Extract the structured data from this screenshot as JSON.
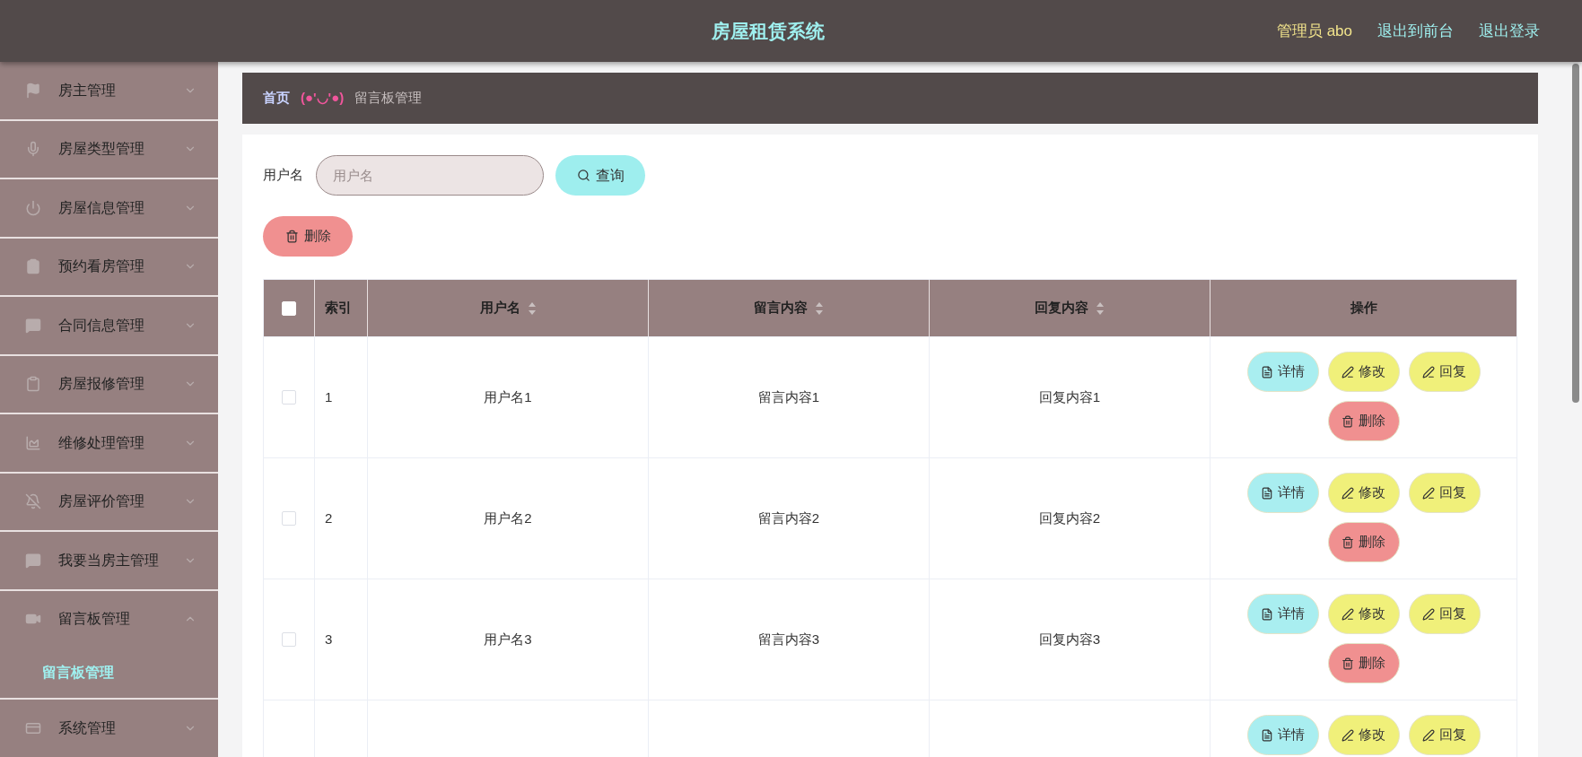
{
  "header": {
    "title": "房屋租赁系统",
    "user": "管理员 abo",
    "links": [
      "退出到前台",
      "退出登录"
    ]
  },
  "sidebar": {
    "items": [
      {
        "label": "房主管理",
        "expanded": false
      },
      {
        "label": "房屋类型管理",
        "expanded": false
      },
      {
        "label": "房屋信息管理",
        "expanded": false
      },
      {
        "label": "预约看房管理",
        "expanded": false
      },
      {
        "label": "合同信息管理",
        "expanded": false
      },
      {
        "label": "房屋报修管理",
        "expanded": false
      },
      {
        "label": "维修处理管理",
        "expanded": false
      },
      {
        "label": "房屋评价管理",
        "expanded": false
      },
      {
        "label": "我要当房主管理",
        "expanded": false
      },
      {
        "label": "留言板管理",
        "expanded": true,
        "children": [
          {
            "label": "留言板管理",
            "selected": true
          }
        ]
      },
      {
        "label": "系统管理",
        "expanded": false
      }
    ]
  },
  "breadcrumb": {
    "home": "首页",
    "separator": "(●'◡'●)",
    "current": "留言板管理"
  },
  "search": {
    "label": "用户名",
    "placeholder": "用户名",
    "button": "查询"
  },
  "bulk_delete": "删除",
  "table": {
    "header_checked": false,
    "columns": [
      {
        "label": "索引",
        "sortable": false
      },
      {
        "label": "用户名",
        "sortable": true
      },
      {
        "label": "留言内容",
        "sortable": true
      },
      {
        "label": "回复内容",
        "sortable": true
      },
      {
        "label": "操作",
        "sortable": false
      }
    ],
    "rows": [
      {
        "checked": false,
        "index": "1",
        "user": "用户名1",
        "message": "留言内容1",
        "reply": "回复内容1",
        "actions": [
          {
            "kind": "detail",
            "label": "详情"
          },
          {
            "kind": "edit",
            "label": "修改"
          },
          {
            "kind": "reply",
            "label": "回复"
          },
          {
            "kind": "delete",
            "label": "删除"
          }
        ]
      },
      {
        "checked": false,
        "index": "2",
        "user": "用户名2",
        "message": "留言内容2",
        "reply": "回复内容2",
        "actions": [
          {
            "kind": "detail",
            "label": "详情"
          },
          {
            "kind": "edit",
            "label": "修改"
          },
          {
            "kind": "reply",
            "label": "回复"
          },
          {
            "kind": "delete",
            "label": "删除"
          }
        ]
      },
      {
        "checked": false,
        "index": "3",
        "user": "用户名3",
        "message": "留言内容3",
        "reply": "回复内容3",
        "actions": [
          {
            "kind": "detail",
            "label": "详情"
          },
          {
            "kind": "edit",
            "label": "修改"
          },
          {
            "kind": "reply",
            "label": "回复"
          },
          {
            "kind": "delete",
            "label": "删除"
          }
        ]
      },
      {
        "actions": [
          {
            "kind": "detail",
            "label": "详情"
          },
          {
            "kind": "edit",
            "label": "修改"
          },
          {
            "kind": "reply",
            "label": "回复"
          }
        ]
      }
    ]
  }
}
